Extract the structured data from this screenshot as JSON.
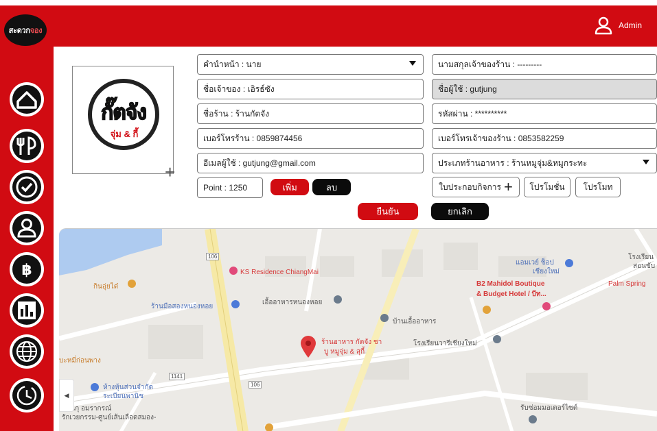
{
  "header": {
    "brand": "สะดวก",
    "brand_accent": "จอง",
    "user": "Admin"
  },
  "sidebar": {
    "items": [
      {
        "name": "home-icon"
      },
      {
        "name": "restaurant-icon"
      },
      {
        "name": "check-icon"
      },
      {
        "name": "user-icon"
      },
      {
        "name": "bitcoin-icon"
      },
      {
        "name": "chart-icon"
      },
      {
        "name": "globe-icon"
      },
      {
        "name": "history-icon"
      }
    ]
  },
  "logo": {
    "text": "กั๊ตจัง",
    "sub": "จุ่ม & กี้"
  },
  "form": {
    "title_prefix": "คำนำหน้า : นาย",
    "owner_name": "ชื่อเจ้าของ : เอิรธ์ซัง",
    "shop_name": "ชื่อร้าน : ร้านกัตจัง",
    "shop_phone": "เบอร์โทรร้าน : 0859874456",
    "email": "อีเมลผู้ใช้ : gutjung@gmail.com",
    "point": "Point  : 1250",
    "add_label": "เพิ่ม",
    "remove_label": "ลบ",
    "owner_lastname": "นามสกุลเจ้าของร้าน : ---------",
    "username": "ชื่อผู้ใช้ : gutjung",
    "password": "รหัสผ่าน :  **********",
    "owner_phone": "เบอร์โทรเจ้าของร้าน : 0853582259",
    "shop_type": "ประเภทร้านอาหาร : ร้านหมูจุ่ม&หมูกระทะ",
    "license_label": "ใบประกอบกิจการ",
    "promotion_label": "โปรโมชั่น",
    "promote_label": "โปรโมท",
    "confirm_label": "ยืนยัน",
    "cancel_label": "ยกเลิก"
  },
  "map": {
    "labels": {
      "ks_residence": "KS Residence ChiangMai",
      "b2_line1": "B2 Mahidol Boutique",
      "b2_line2": "& Budget Hotel / บีท...",
      "palm": "Palm Spring",
      "shop_line1": "ร้านอาหาร กัตจัง ชา",
      "shop_line2": "บู หมูจุ่ม & สุกี้",
      "ban_ue": "บ้านเอื้ออาหาร",
      "ue_ahan_nong": "เอื้ออาหารหนองหอย",
      "ran_mue": "ร้านมือสองหนองหอย",
      "school": "โรงเรียนวารีเชียงใหม่",
      "mall_line1": "แอมเวย์ ช็อป",
      "mall_line2": "เชียงใหม่",
      "kin_oi": "กินอุ่ยได๋",
      "hang_line1": "ห้างหุ้นส่วนจำกัด",
      "hang_line2": "ระเบียนพานิช",
      "bottom_left1": "แผนกุ อมรากรณ์",
      "bottom_left2": "รักเวยกรรม-ศูนย์เส้นเลือดสมอง-",
      "noodle": "บะหมี่ก่อนพาง",
      "road_106a": "106",
      "road_106b": "106",
      "road_1141": "1141",
      "repair": "รับซ่อมมอเตอร์ไซต์",
      "school_right1": "โรงเรียน",
      "school_right2": "สอนขับ"
    }
  }
}
